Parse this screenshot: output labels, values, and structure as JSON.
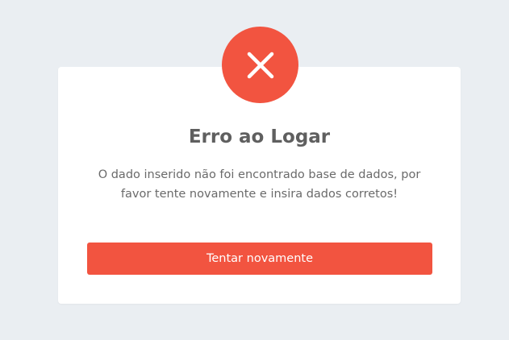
{
  "dialog": {
    "title": "Erro ao Logar",
    "message": "O dado inserido não foi encontrado base de dados, por favor tente novamente e insira dados corretos!",
    "retry_label": "Tentar novamente",
    "icon": "close-icon"
  },
  "colors": {
    "background": "#eaeef2",
    "accent": "#f25440",
    "card": "#ffffff",
    "title": "#5f5f5f",
    "text": "#6a6a6a"
  }
}
